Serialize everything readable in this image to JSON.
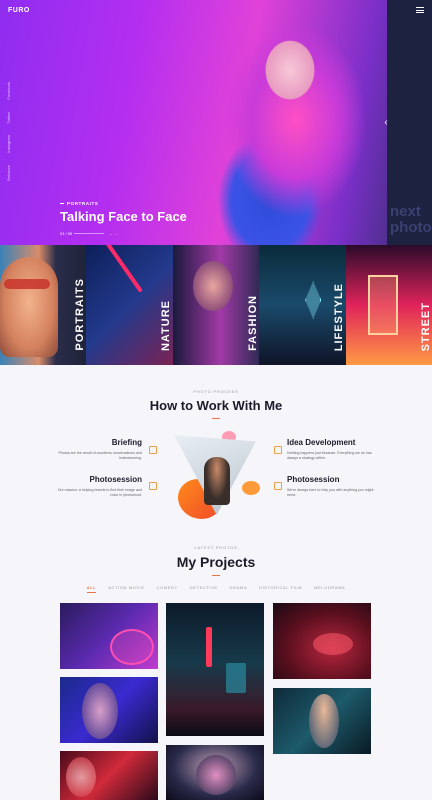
{
  "header": {
    "logo": "FURO",
    "menu_icon": "hamburger-icon"
  },
  "hero": {
    "tag": "PORTRAITS",
    "title": "Talking Face to Face",
    "counter": "01 / 05",
    "next_label": "next photo",
    "social": [
      "Facebook",
      "Twitter",
      "Instagram",
      "Behance"
    ]
  },
  "categories": [
    {
      "label": "PORTRAITS"
    },
    {
      "label": "NATURE"
    },
    {
      "label": "FASHION"
    },
    {
      "label": "LIFESTYLE"
    },
    {
      "label": "STREET"
    }
  ],
  "services_section": {
    "subtitle": "PHOTO PROCESS",
    "title": "How to Work With Me",
    "items": [
      {
        "title": "Briefing",
        "text": "Photos are the result of countless conversations and brainstorming."
      },
      {
        "title": "Photosession",
        "text": "Our mission: a helping brands to find their image and voice in photoshoot."
      },
      {
        "title": "Idea Development",
        "text": "Nothing happens just because. Everything we do has always a strategy within."
      },
      {
        "title": "Photosession",
        "text": "We're always here to help you with anything you might need."
      }
    ]
  },
  "projects": {
    "subtitle": "LATEST PHOTOS",
    "title": "My Projects",
    "filters": [
      "ALL",
      "ACTION MOVIE",
      "COMEDY",
      "DETECTIVE",
      "DRAMA",
      "HISTORICAL FILM",
      "MELODRAMA"
    ],
    "active_filter": "ALL"
  },
  "colors": {
    "accent": "#e9734a",
    "hero_purple": "#b42ef0",
    "hero_pink": "#e142d8"
  }
}
